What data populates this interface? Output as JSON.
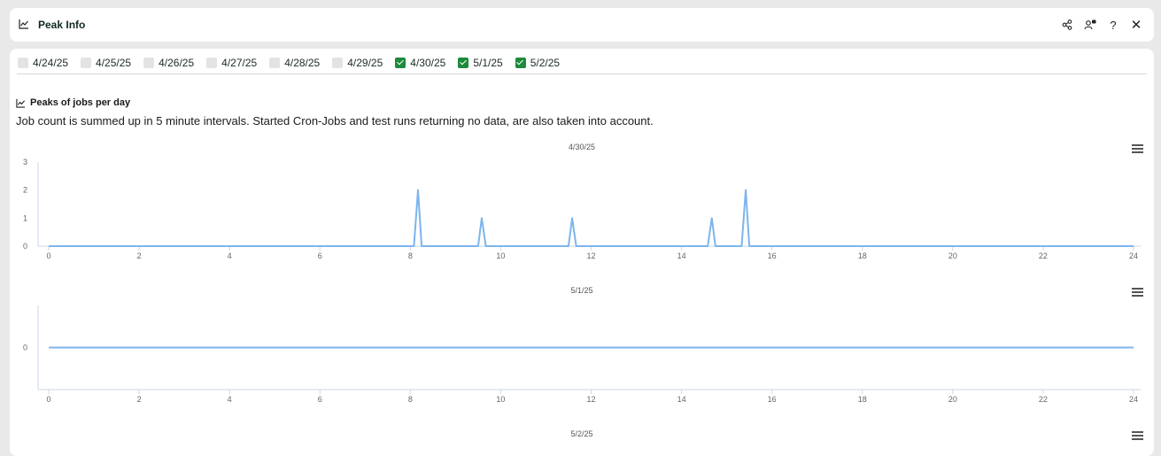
{
  "window": {
    "title": "Peak Info",
    "title_icon": "line-chart-icon",
    "actions": [
      {
        "name": "share-icon",
        "label": ""
      },
      {
        "name": "user-status-icon",
        "label": ""
      },
      {
        "name": "help-icon",
        "label": "?"
      },
      {
        "name": "close-icon",
        "label": "✕"
      }
    ]
  },
  "dates": [
    {
      "label": "4/24/25",
      "checked": false
    },
    {
      "label": "4/25/25",
      "checked": false
    },
    {
      "label": "4/26/25",
      "checked": false
    },
    {
      "label": "4/27/25",
      "checked": false
    },
    {
      "label": "4/28/25",
      "checked": false
    },
    {
      "label": "4/29/25",
      "checked": false
    },
    {
      "label": "4/30/25",
      "checked": true
    },
    {
      "label": "5/1/25",
      "checked": true
    },
    {
      "label": "5/2/25",
      "checked": true
    }
  ],
  "section": {
    "title": "Peaks of jobs per day",
    "description": "Job count is summed up in 5 minute intervals. Started Cron-Jobs and test runs returning no data, are also taken into account."
  },
  "colors": {
    "accent": "#1d8a3c",
    "line": "#7cb5ec",
    "axis": "#ccd6eb"
  },
  "chart_data": [
    {
      "type": "line",
      "title": "4/30/25",
      "xlabel": "",
      "ylabel": "",
      "xlim": [
        0,
        24
      ],
      "ylim": [
        0,
        3
      ],
      "x_ticks": [
        0,
        2,
        4,
        6,
        8,
        10,
        12,
        14,
        16,
        18,
        20,
        22,
        24
      ],
      "y_ticks": [
        0,
        1,
        2,
        3
      ],
      "series": [
        {
          "x": [
            0,
            8.08,
            8.17,
            8.25,
            9.5,
            9.58,
            9.67,
            11.5,
            11.58,
            11.67,
            14.58,
            14.67,
            14.75,
            15.33,
            15.42,
            15.5,
            24
          ],
          "y": [
            0,
            0,
            2,
            0,
            0,
            1,
            0,
            0,
            1,
            0,
            0,
            1,
            0,
            0,
            2,
            0,
            0
          ]
        }
      ],
      "grid": false,
      "legend": "none"
    },
    {
      "type": "line",
      "title": "5/1/25",
      "xlabel": "",
      "ylabel": "",
      "xlim": [
        0,
        24
      ],
      "ylim": [
        -1,
        1
      ],
      "x_ticks": [
        0,
        2,
        4,
        6,
        8,
        10,
        12,
        14,
        16,
        18,
        20,
        22,
        24
      ],
      "y_ticks": [
        0
      ],
      "series": [
        {
          "x": [
            0,
            24
          ],
          "y": [
            0,
            0
          ]
        }
      ],
      "grid": false,
      "legend": "none"
    },
    {
      "type": "line",
      "title": "5/2/25",
      "xlabel": "",
      "ylabel": "",
      "series": []
    }
  ]
}
